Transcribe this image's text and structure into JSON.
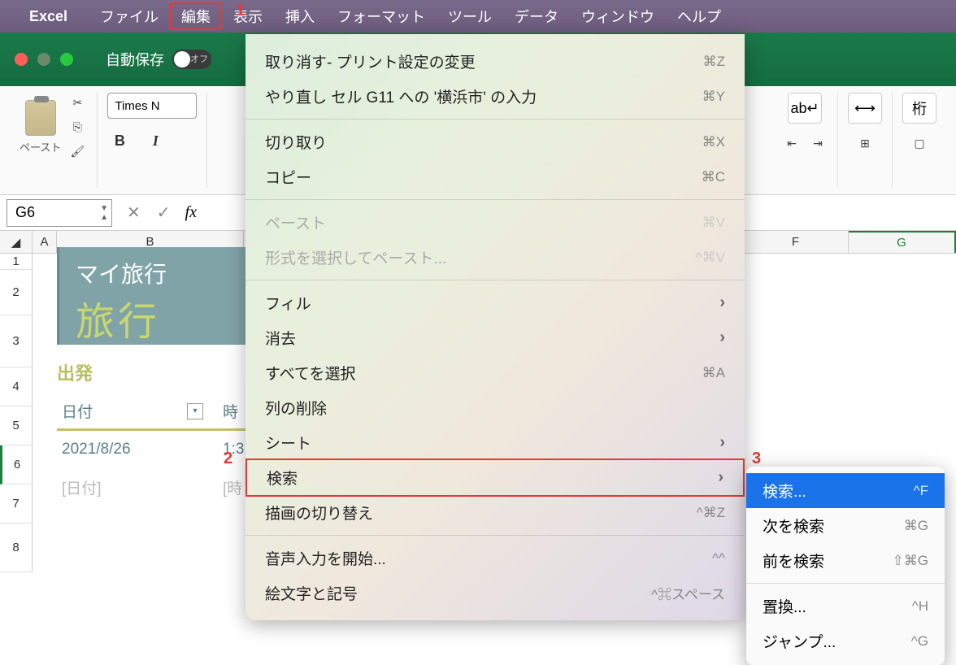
{
  "menubar": {
    "app": "Excel",
    "items": [
      "ファイル",
      "編集",
      "表示",
      "挿入",
      "フォーマット",
      "ツール",
      "データ",
      "ウィンドウ",
      "ヘルプ"
    ],
    "highlighted_index": 1
  },
  "titlebar": {
    "autosave_label": "自動保存",
    "autosave_state": "オフ"
  },
  "ribbon": {
    "paste_label": "ペースト",
    "font_name": "Times N",
    "bold": "B",
    "italic": "I"
  },
  "fxbar": {
    "cell_ref": "G6",
    "fx": "fx"
  },
  "columns": [
    "",
    "A",
    "B",
    "",
    "F",
    "G"
  ],
  "rows": [
    "1",
    "2",
    "3",
    "4",
    "5",
    "6",
    "7",
    "8"
  ],
  "banner": {
    "title1": "マイ旅行",
    "title2": "旅行"
  },
  "table": {
    "section": "出発",
    "col1": "日付",
    "col2": "時",
    "r1c1": "2021/8/26",
    "r1c2": "1:3",
    "r2c1": "[日付]",
    "r2c2": "[時"
  },
  "edit_menu": [
    {
      "label": "取り消す- プリント設定の変更",
      "shortcut": "⌘Z"
    },
    {
      "label": "やり直し セル G11 への '横浜市' の入力",
      "shortcut": "⌘Y"
    },
    {
      "sep": true
    },
    {
      "label": "切り取り",
      "shortcut": "⌘X"
    },
    {
      "label": "コピー",
      "shortcut": "⌘C"
    },
    {
      "sep": true
    },
    {
      "label": "ペースト",
      "shortcut": "⌘V",
      "disabled": true
    },
    {
      "label": "形式を選択してペースト...",
      "shortcut": "^⌘V",
      "disabled": true
    },
    {
      "sep": true
    },
    {
      "label": "フィル",
      "submenu": true
    },
    {
      "label": "消去",
      "submenu": true
    },
    {
      "label": "すべてを選択",
      "shortcut": "⌘A"
    },
    {
      "label": "列の削除"
    },
    {
      "label": "シート",
      "submenu": true
    },
    {
      "label": "検索",
      "submenu": true,
      "highlight": true
    },
    {
      "label": "描画の切り替え",
      "shortcut": "^⌘Z"
    },
    {
      "sep": true
    },
    {
      "label": "音声入力を開始...",
      "shortcut": "^^"
    },
    {
      "label": "絵文字と記号",
      "shortcut": "^⌘スペース"
    }
  ],
  "find_submenu": [
    {
      "label": "検索...",
      "shortcut": "^F",
      "selected": true
    },
    {
      "label": "次を検索",
      "shortcut": "⌘G"
    },
    {
      "label": "前を検索",
      "shortcut": "⇧⌘G"
    },
    {
      "sep": true
    },
    {
      "label": "置換...",
      "shortcut": "^H"
    },
    {
      "label": "ジャンプ...",
      "shortcut": "^G"
    }
  ],
  "annotations": {
    "l1": "1",
    "l2": "2",
    "l3": "3"
  }
}
